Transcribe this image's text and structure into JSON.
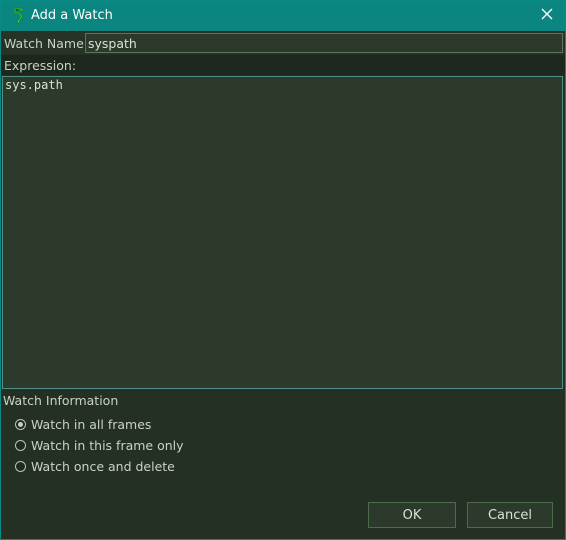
{
  "window": {
    "title": "Add a Watch",
    "app_icon": "python-snake-icon",
    "close_icon": "close-icon",
    "accent_color": "#0b8580"
  },
  "form": {
    "watch_name_label": "Watch Name:",
    "watch_name_value": "syspath",
    "expression_label": "Expression:",
    "expression_value": "sys.path"
  },
  "watch_info": {
    "heading": "Watch Information",
    "options": [
      {
        "label": "Watch in all frames",
        "checked": true
      },
      {
        "label": "Watch in this frame only",
        "checked": false
      },
      {
        "label": "Watch once and delete",
        "checked": false
      }
    ]
  },
  "buttons": {
    "ok_label": "OK",
    "cancel_label": "Cancel"
  }
}
